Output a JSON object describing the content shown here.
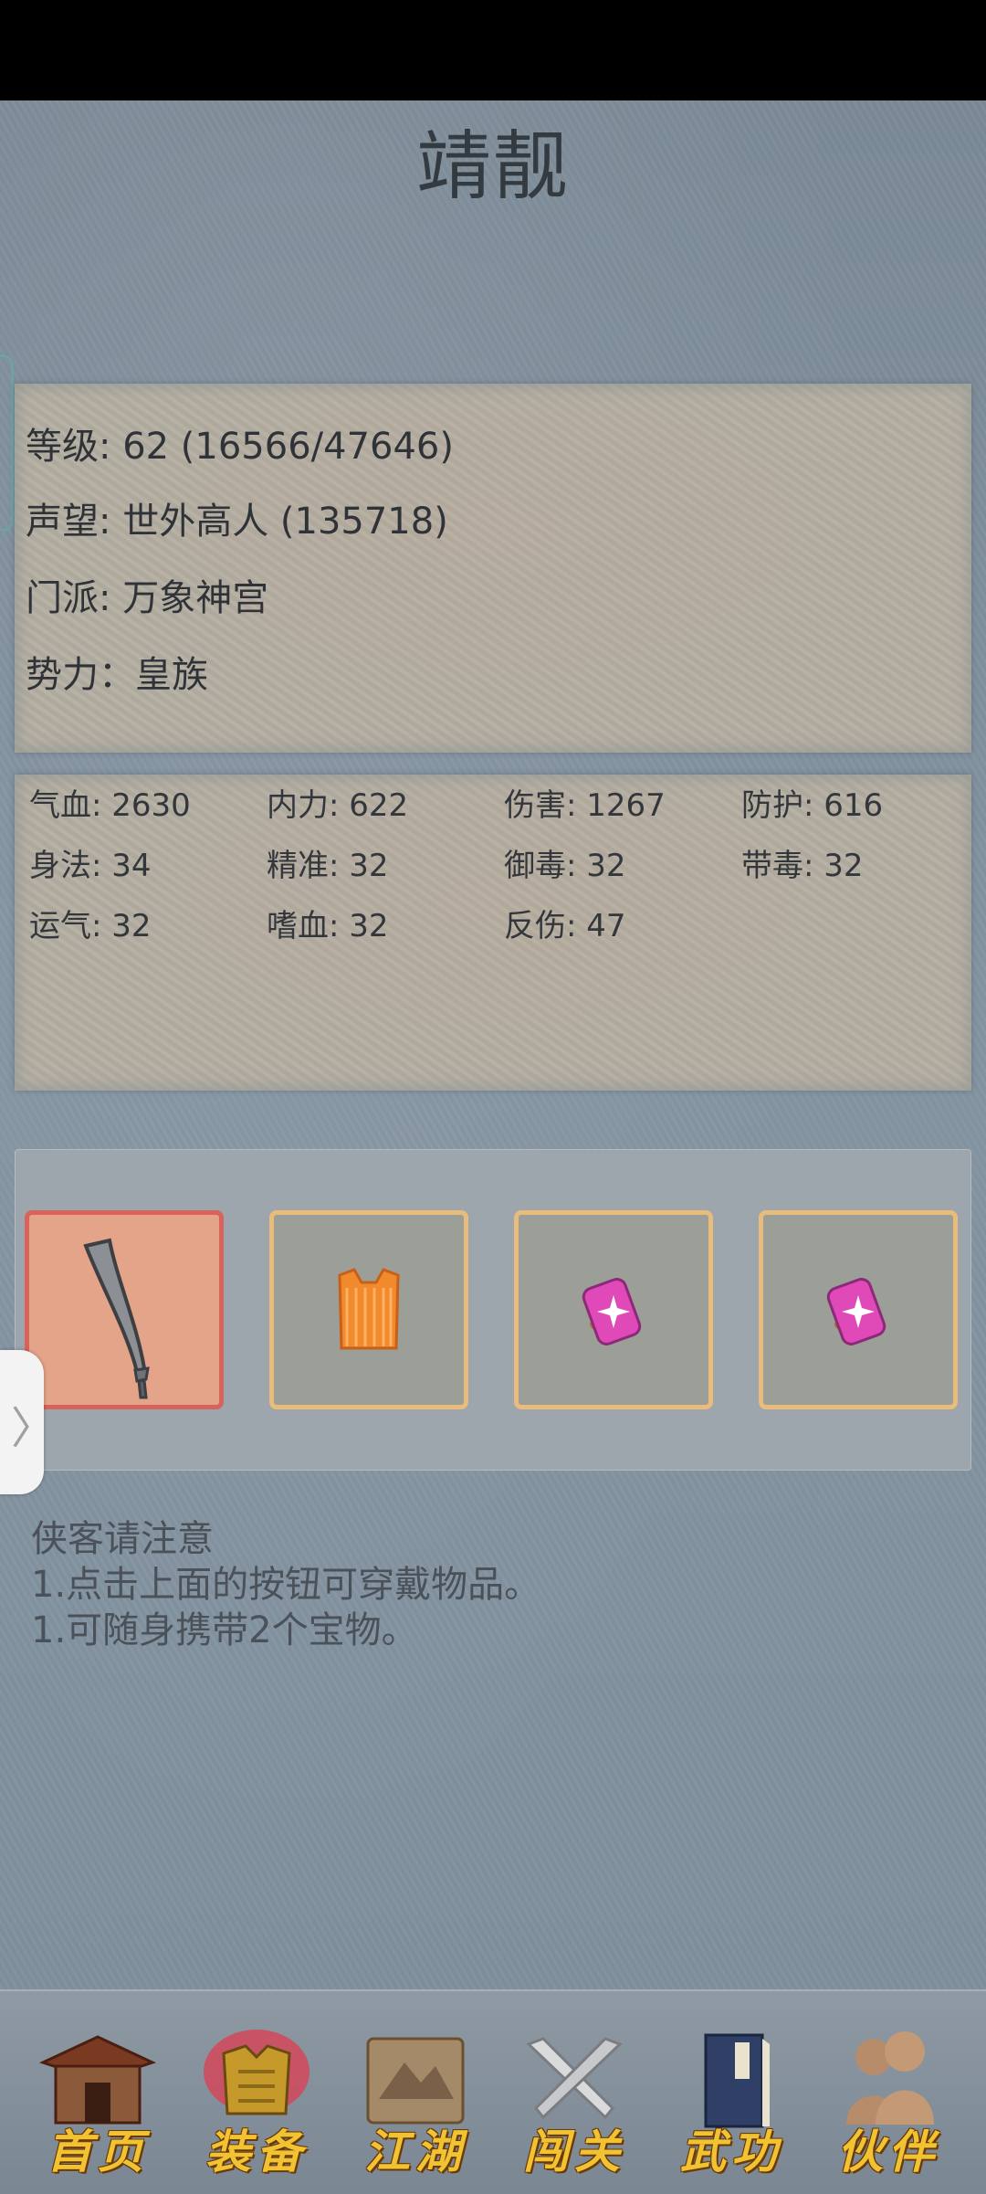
{
  "header": {
    "title": "靖靓"
  },
  "info": {
    "level": "等级: 62 (16566/47646)",
    "reputation": "声望: 世外高人 (135718)",
    "sect": "门派: 万象神宫",
    "faction": "势力：皇族"
  },
  "stats": [
    "气血: 2630",
    "内力: 622",
    "伤害: 1267",
    "防护: 616",
    "身法: 34",
    "精准: 32",
    "御毒: 32",
    "带毒: 32",
    "运气: 32",
    "嗜血: 32",
    "反伤: 47"
  ],
  "equipment": {
    "slots": [
      {
        "icon": "saber-icon"
      },
      {
        "icon": "armor-vest-icon"
      },
      {
        "icon": "treasure-charm-icon"
      },
      {
        "icon": "treasure-charm-icon"
      }
    ]
  },
  "drawer": {
    "glyph": "〉"
  },
  "notice": {
    "title": "侠客请注意",
    "line1": "1.点击上面的按钮可穿戴物品。",
    "line2": "1.可随身携带2个宝物。"
  },
  "nav": {
    "items": [
      {
        "label": "首页",
        "icon": "home-gate-icon"
      },
      {
        "label": "装备",
        "icon": "armor-icon"
      },
      {
        "label": "江湖",
        "icon": "scroll-map-icon"
      },
      {
        "label": "闯关",
        "icon": "crossed-swords-icon"
      },
      {
        "label": "武功",
        "icon": "martial-book-icon"
      },
      {
        "label": "伙伴",
        "icon": "companions-icon"
      }
    ],
    "active": "装备"
  },
  "colors": {
    "accent_gold": "#f1c232",
    "slot_border": "#e9bc7c",
    "active_slot_border": "#d9625a"
  }
}
